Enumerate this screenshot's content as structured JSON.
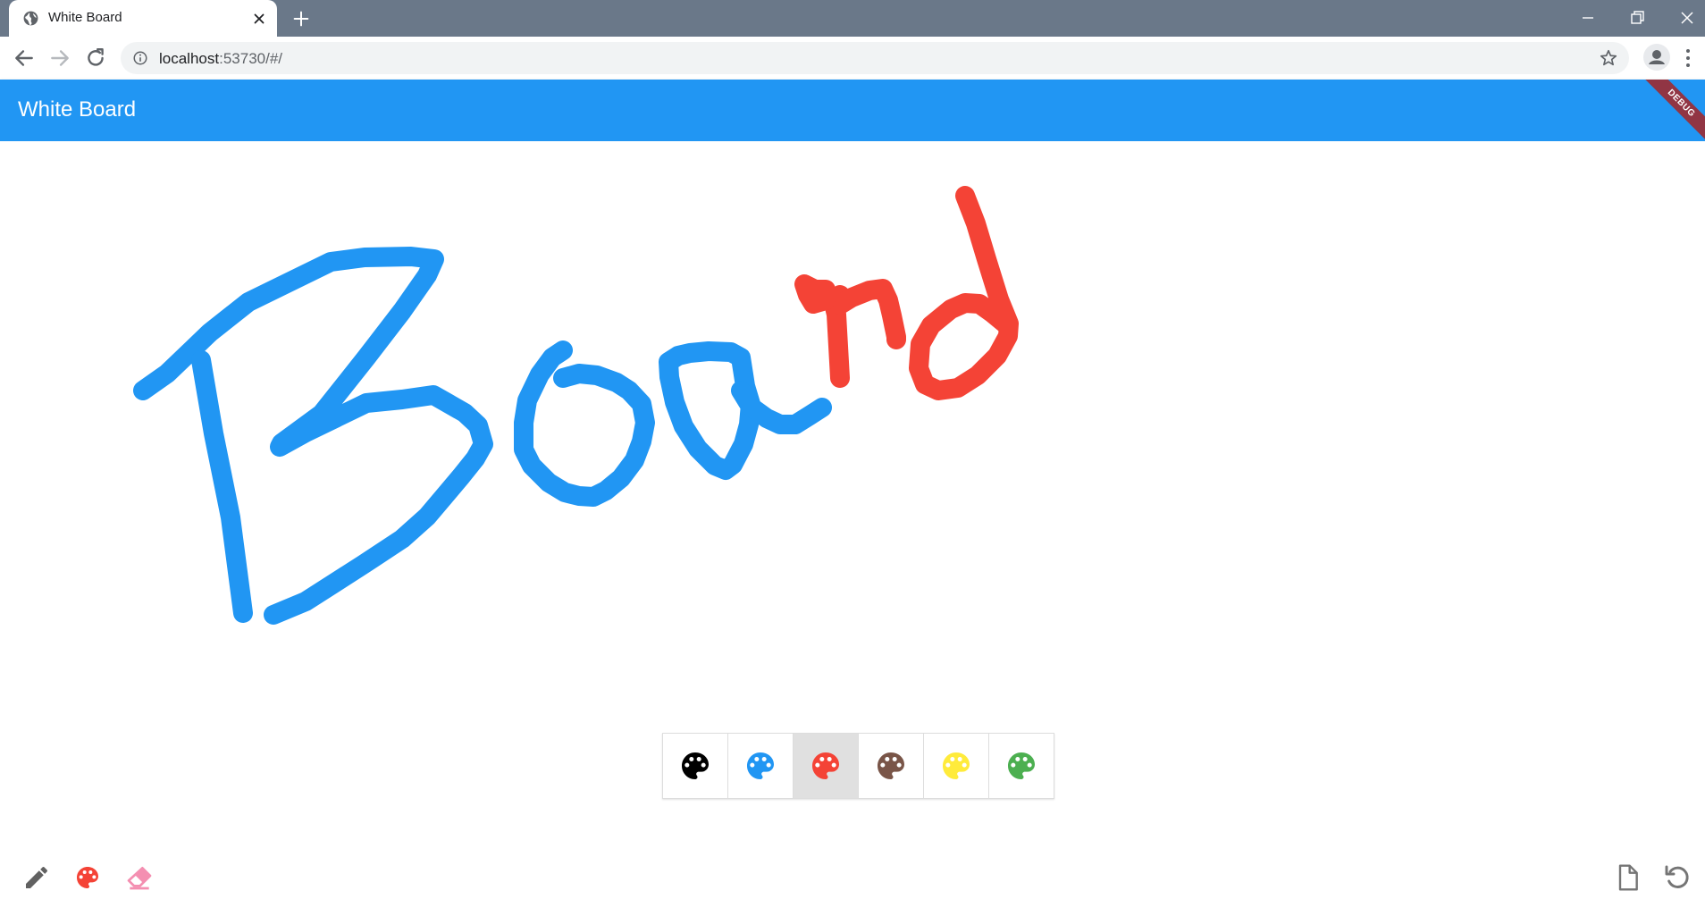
{
  "browser": {
    "tab_title": "White Board",
    "url_host": "localhost",
    "url_rest": ":53730/#/"
  },
  "app": {
    "title": "White Board",
    "debug_banner": "DEBUG",
    "drawing_text": "Board",
    "drawing_strokes": [
      {
        "letters": "Boa",
        "color": "#2196f3"
      },
      {
        "letters": "rd",
        "color": "#f44336"
      }
    ]
  },
  "palette": {
    "selected_index": 2,
    "colors": [
      {
        "name": "black",
        "hex": "#000000"
      },
      {
        "name": "blue",
        "hex": "#2196f3"
      },
      {
        "name": "red",
        "hex": "#f44336"
      },
      {
        "name": "brown",
        "hex": "#795548"
      },
      {
        "name": "yellow",
        "hex": "#ffeb3b"
      },
      {
        "name": "green",
        "hex": "#4caf50"
      }
    ]
  },
  "tools": {
    "left": [
      {
        "icon": "pencil-icon",
        "color": "#616161"
      },
      {
        "icon": "palette-icon",
        "color": "#f44336"
      },
      {
        "icon": "eraser-icon",
        "color": "#f48fb1"
      }
    ],
    "right": [
      {
        "icon": "new-page-icon",
        "color": "#757575"
      },
      {
        "icon": "undo-icon",
        "color": "#757575"
      }
    ]
  }
}
